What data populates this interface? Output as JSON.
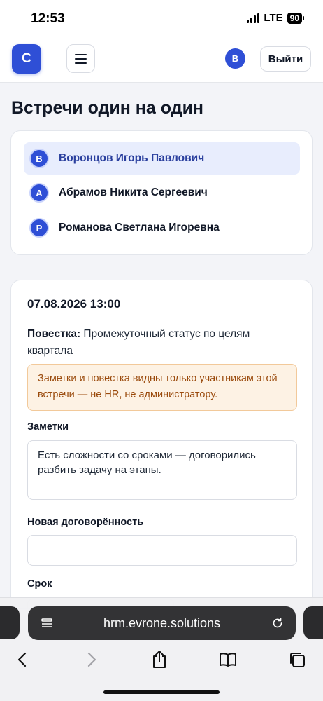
{
  "status_bar": {
    "time": "12:53",
    "network": "LTE",
    "battery": "90"
  },
  "header": {
    "logo_letter": "C",
    "user_initial": "В",
    "logout_label": "Выйти"
  },
  "page": {
    "title": "Встречи один на один"
  },
  "participants": [
    {
      "initial": "В",
      "name": "Воронцов Игорь Павлович",
      "active": true
    },
    {
      "initial": "А",
      "name": "Абрамов Никита Сергеевич",
      "active": false
    },
    {
      "initial": "Р",
      "name": "Романова Светлана Игоревна",
      "active": false
    }
  ],
  "meeting": {
    "datetime": "07.08.2026 13:00",
    "agenda_label": "Повестка:",
    "agenda_text": " Промежуточный статус по целям квартала",
    "notice": "Заметки и повестка видны только участникам этой встречи — не HR, не администратору.",
    "notes_label": "Заметки",
    "notes_text": "Есть сложности со сроками — договорились разбить задачу на этапы.",
    "new_agreement_label": "Новая договорённость",
    "new_agreement_value": "",
    "due_label": "Срок"
  },
  "browser": {
    "url": "hrm.evrone.solutions"
  },
  "colors": {
    "accent": "#2f4fd6",
    "active_row": "#e8edfd",
    "notice_bg": "#fdf2e4",
    "notice_text": "#9a4a0c"
  }
}
